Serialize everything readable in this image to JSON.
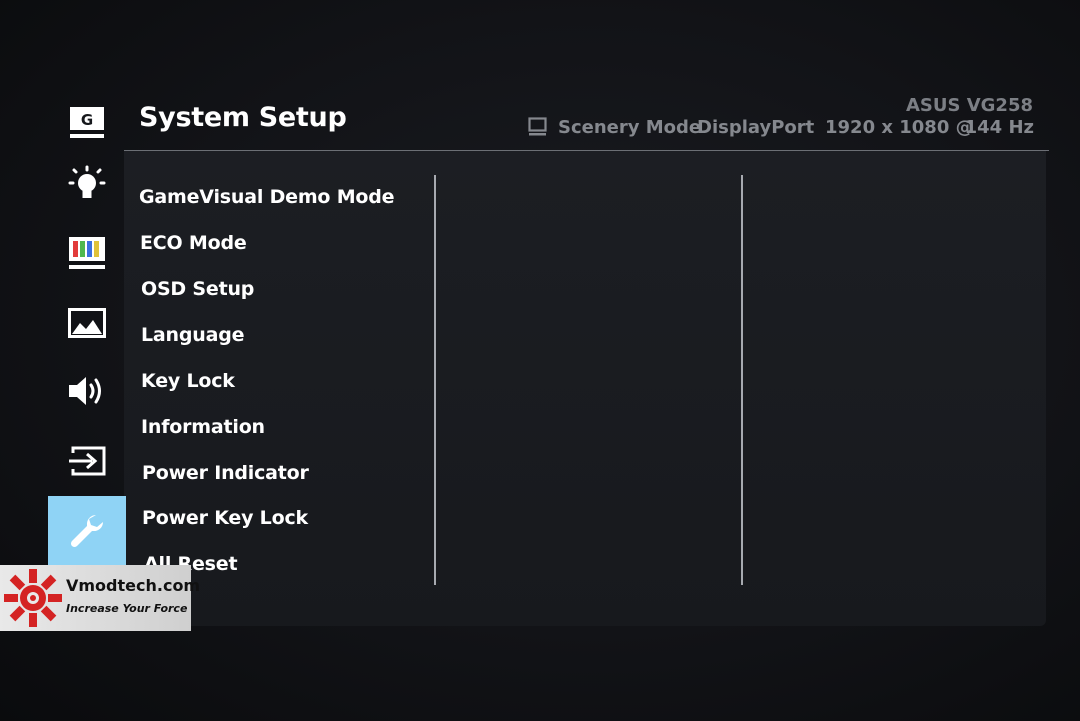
{
  "header": {
    "title": "System Setup",
    "model": "ASUS VG258",
    "scenery_mode": "Scenery Mode",
    "input_port": "DisplayPort",
    "resolution": "1920 x 1080 @",
    "refresh_rate": "144 Hz"
  },
  "sidebar": {
    "items": [
      {
        "name": "gamevisual",
        "icon": "g-icon",
        "label": "G"
      },
      {
        "name": "blue-light-filter",
        "icon": "bulb-icon"
      },
      {
        "name": "color",
        "icon": "color-bars-icon"
      },
      {
        "name": "image",
        "icon": "image-icon"
      },
      {
        "name": "sound",
        "icon": "speaker-icon"
      },
      {
        "name": "input-select",
        "icon": "input-icon"
      },
      {
        "name": "system-setup",
        "icon": "wrench-icon",
        "active": true
      },
      {
        "name": "shortcut",
        "icon": "chevron-down-icon"
      }
    ],
    "active_color": "#8fd3f5"
  },
  "menu": {
    "items": [
      "GameVisual Demo Mode",
      "ECO Mode",
      "OSD Setup",
      "Language",
      "Key Lock",
      "Information",
      "Power Indicator",
      "Power Key Lock",
      "All Reset"
    ]
  },
  "watermark": {
    "name": "Vmodtech.com",
    "tagline": "Increase Your Force"
  }
}
